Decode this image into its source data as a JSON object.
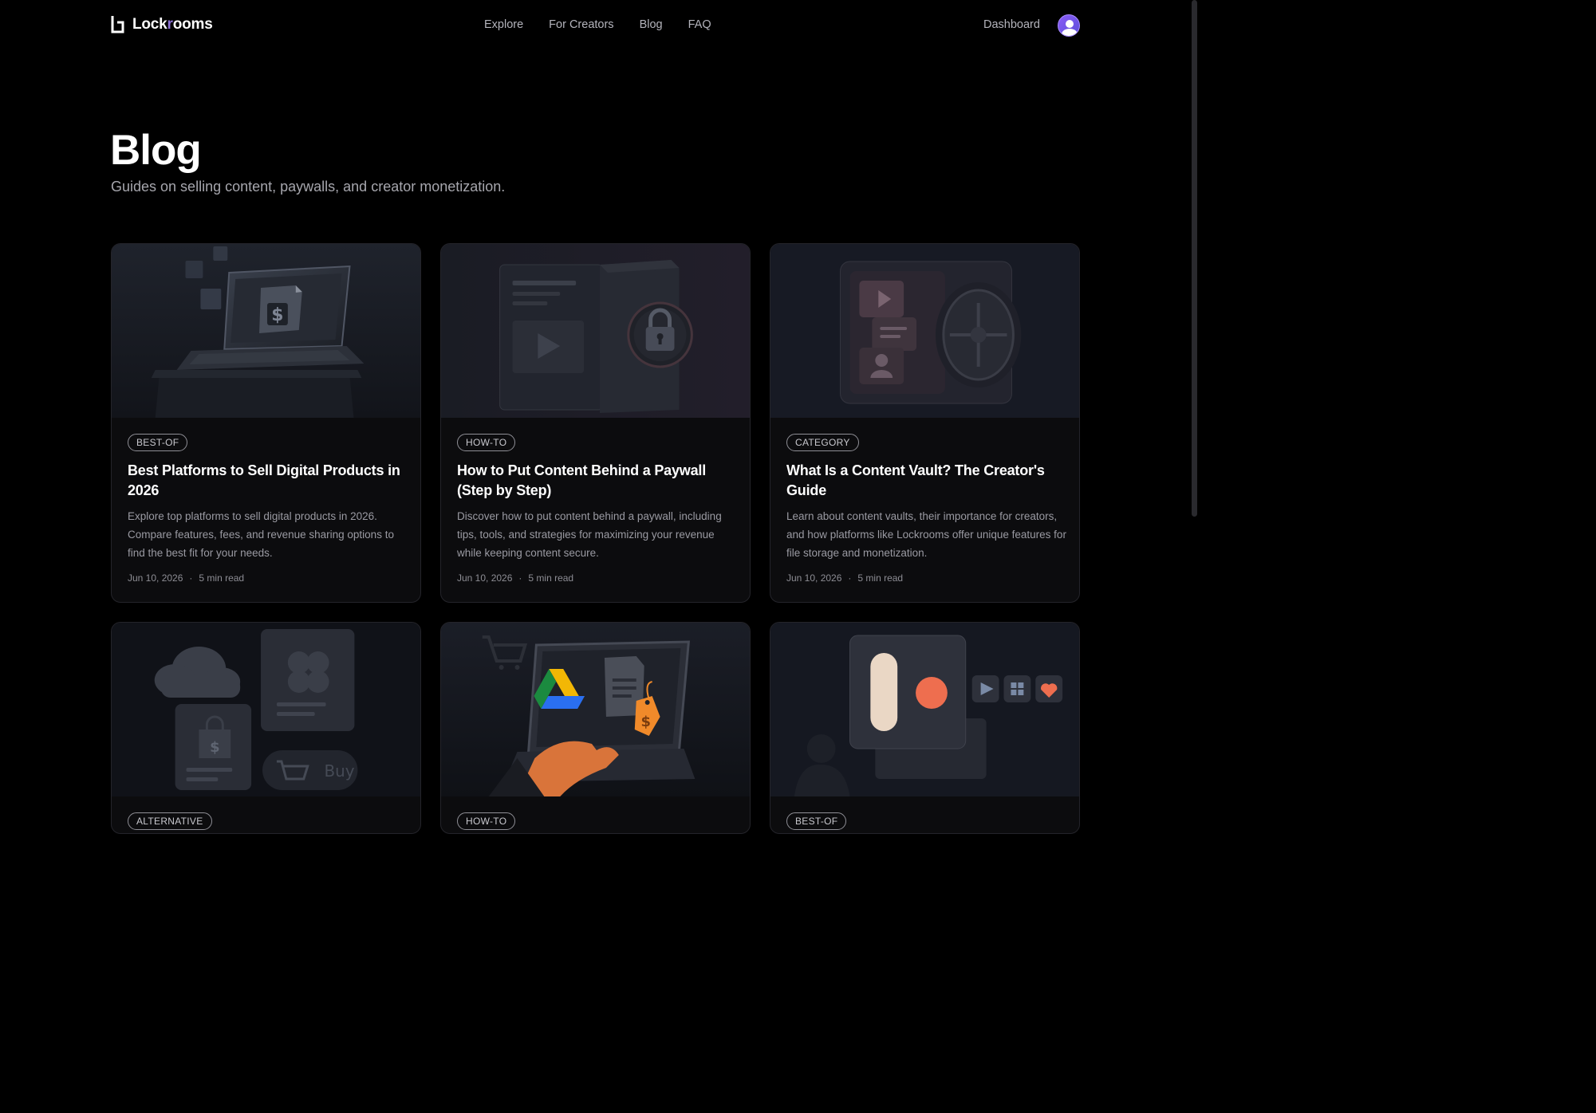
{
  "brand": {
    "name_part1": "Lock",
    "name_part2": "r",
    "name_part3": "ooms"
  },
  "nav": [
    "Explore",
    "For Creators",
    "Blog",
    "FAQ"
  ],
  "header_right": {
    "dashboard": "Dashboard"
  },
  "page": {
    "title": "Blog",
    "subtitle": "Guides on selling content, paywalls, and creator monetization."
  },
  "posts": [
    {
      "tag": "BEST-OF",
      "title": "Best Platforms to Sell Digital Products in 2026",
      "description": "Explore top platforms to sell digital products in 2026. Compare features, fees, and revenue sharing options to find the best fit for your needs.",
      "date": "Jun 10, 2026",
      "read_time": "5 min read"
    },
    {
      "tag": "HOW-TO",
      "title": "How to Put Content Behind a Paywall (Step by Step)",
      "description": "Discover how to put content behind a paywall, including tips, tools, and strategies for maximizing your revenue while keeping content secure.",
      "date": "Jun 10, 2026",
      "read_time": "5 min read"
    },
    {
      "tag": "CATEGORY",
      "title": "What Is a Content Vault? The Creator's Guide",
      "description": "Learn about content vaults, their importance for creators, and how platforms like Lockrooms offer unique features for file storage and monetization.",
      "date": "Jun 10, 2026",
      "read_time": "5 min read"
    },
    {
      "tag": "ALTERNATIVE",
      "thumb_text": "Buy"
    },
    {
      "tag": "HOW-TO"
    },
    {
      "tag": "BEST-OF"
    }
  ],
  "meta_separator": "·",
  "icons": {
    "logo": "lockrooms-logo-icon",
    "avatar": "user-avatar-icon"
  },
  "colors": {
    "background": "#000000",
    "accent": "#8a5cf6",
    "price_tag": "#f08a2a"
  }
}
